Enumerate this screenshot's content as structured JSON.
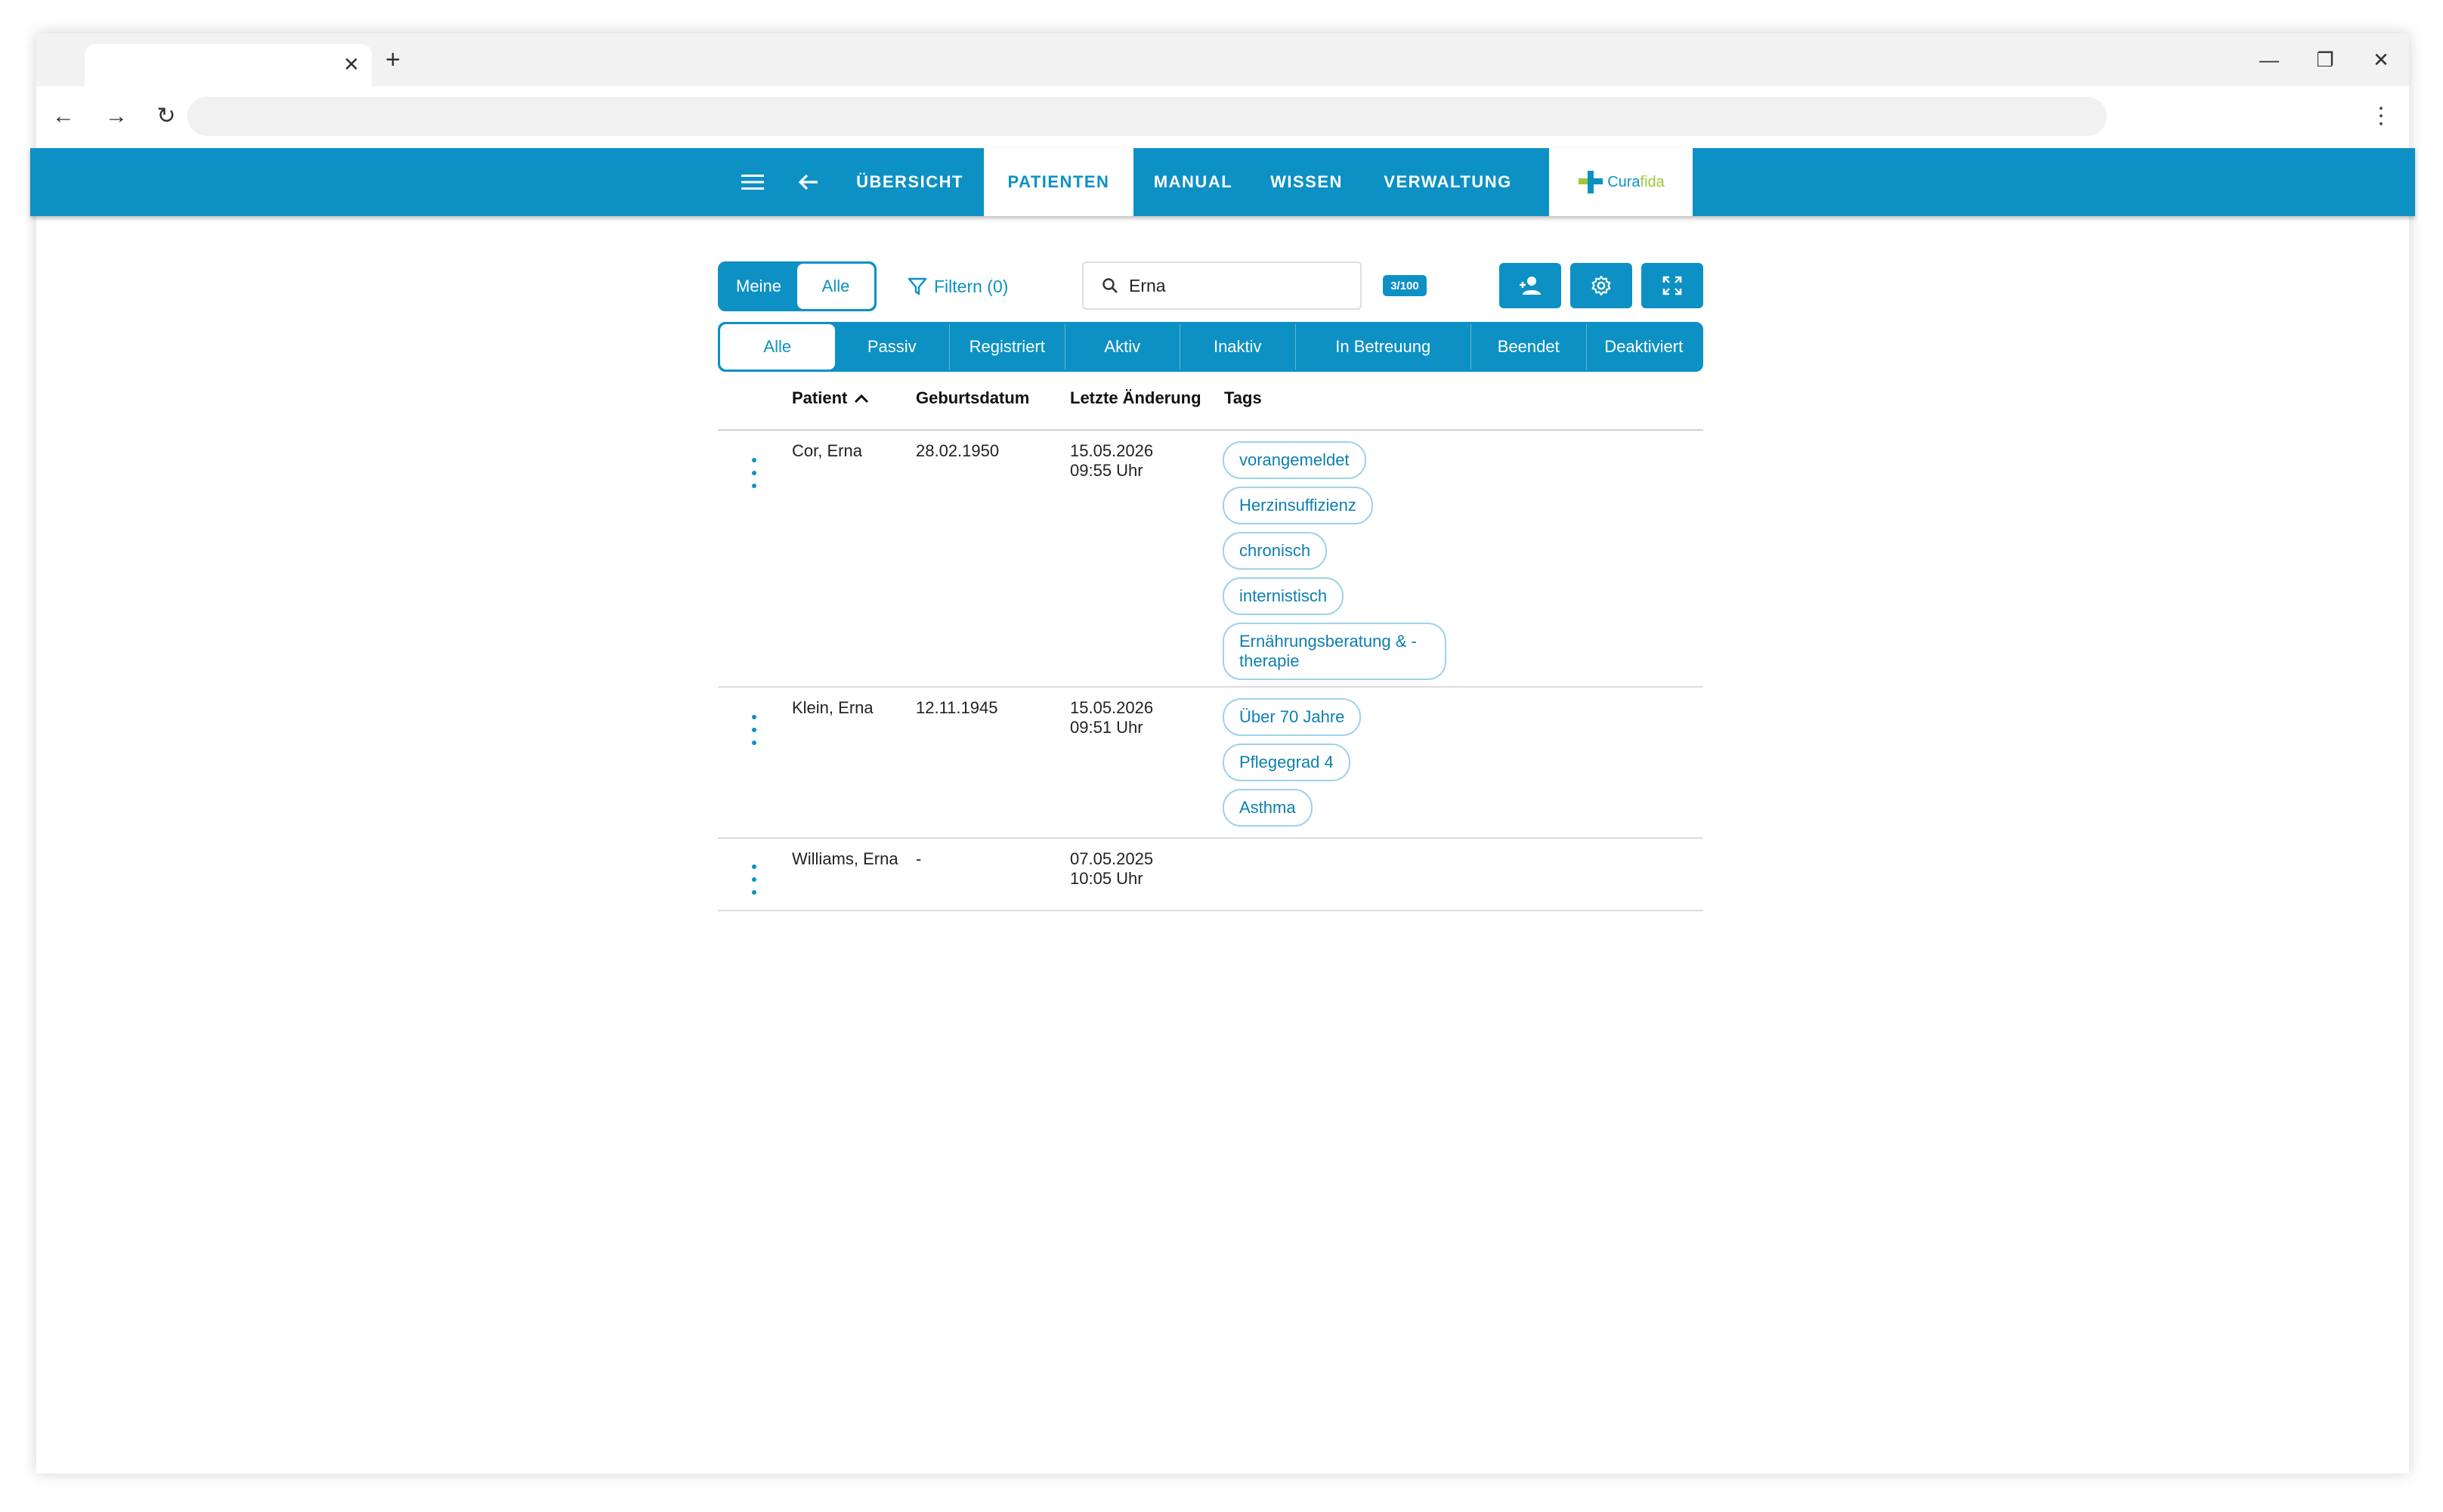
{
  "app": {
    "nav": [
      {
        "label": "ÜBERSICHT",
        "active": false
      },
      {
        "label": "PATIENTEN",
        "active": true
      },
      {
        "label": "MANUAL",
        "active": false
      },
      {
        "label": "WISSEN",
        "active": false
      },
      {
        "label": "VERWALTUNG",
        "active": false
      }
    ],
    "logo": {
      "part1": "Cura",
      "part2": "fida"
    },
    "brand_color": "#0d91c4",
    "accent_color": "#9bc93a"
  },
  "toolbar": {
    "toggle": {
      "meine": "Meine",
      "alle": "Alle"
    },
    "filter_label": "Filtern (0)",
    "search_value": "Erna",
    "count_badge": "3/100",
    "actions": [
      "add-user-icon",
      "gear-icon",
      "expand-icon"
    ]
  },
  "status_tabs": [
    {
      "label": "Alle",
      "active": true
    },
    {
      "label": "Passiv",
      "active": false
    },
    {
      "label": "Registriert",
      "active": false
    },
    {
      "label": "Aktiv",
      "active": false
    },
    {
      "label": "Inaktiv",
      "active": false
    },
    {
      "label": "In Betreuung",
      "active": false
    },
    {
      "label": "Beendet",
      "active": false
    },
    {
      "label": "Deaktiviert",
      "active": false
    }
  ],
  "table": {
    "headers": {
      "patient": "Patient",
      "birth": "Geburtsdatum",
      "changed": "Letzte Änderung",
      "tags": "Tags"
    },
    "rows": [
      {
        "name": "Cor, Erna",
        "birth": "28.02.1950",
        "date": "15.05.2026",
        "time": "09:55 Uhr",
        "tags": [
          "vorangemeldet",
          "Herzinsuffizienz",
          "chronisch",
          "internistisch",
          "Ernährungsberatung & -therapie"
        ]
      },
      {
        "name": "Klein, Erna",
        "birth": "12.11.1945",
        "date": "15.05.2026",
        "time": "09:51 Uhr",
        "tags": [
          "Über 70 Jahre",
          "Pflegegrad 4",
          "Asthma"
        ]
      },
      {
        "name": "Williams, Erna",
        "birth": "-",
        "date": "07.05.2025",
        "time": "10:05 Uhr",
        "tags": []
      }
    ]
  }
}
